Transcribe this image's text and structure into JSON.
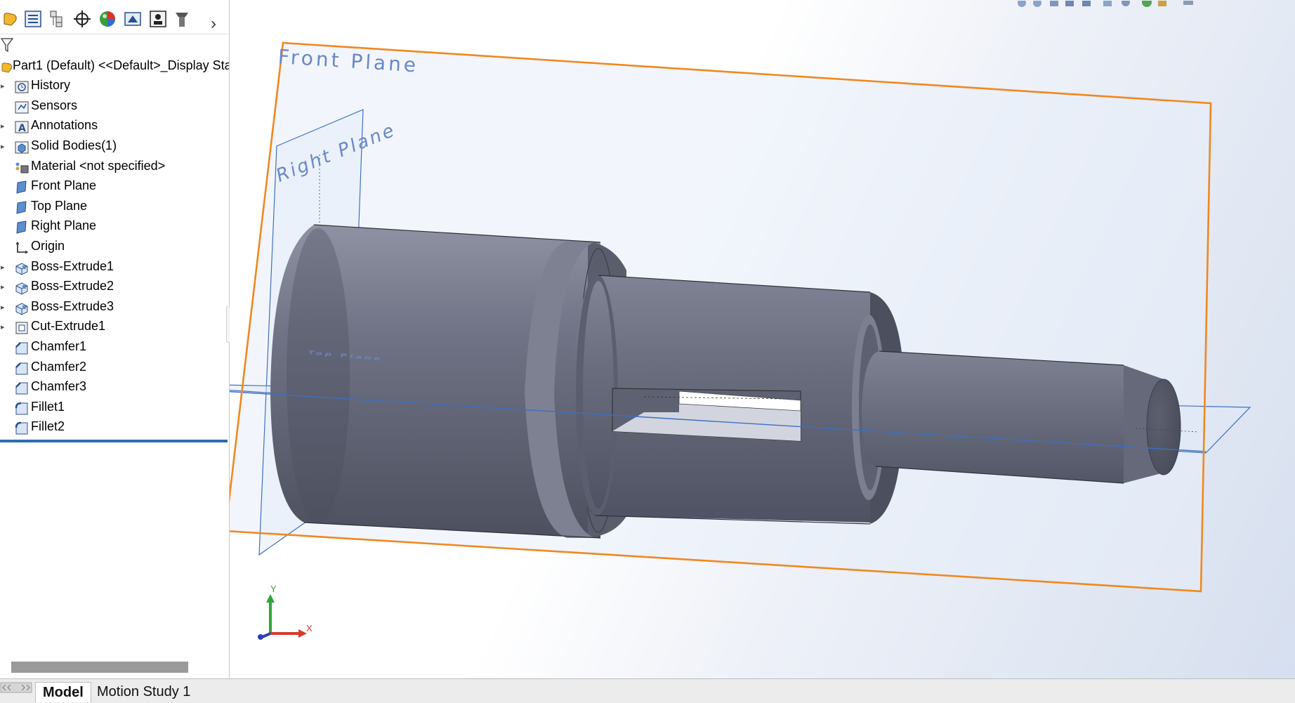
{
  "feature_manager": {
    "root": "Part1 (Default) <<Default>_Display Sta",
    "items": [
      {
        "label": "History",
        "icon": "history-icon",
        "expandable": true
      },
      {
        "label": "Sensors",
        "icon": "sensors-icon",
        "expandable": false
      },
      {
        "label": "Annotations",
        "icon": "annotations-icon",
        "expandable": true
      },
      {
        "label": "Solid Bodies(1)",
        "icon": "solid-bodies-icon",
        "expandable": true
      },
      {
        "label": "Material <not specified>",
        "icon": "material-icon",
        "expandable": false
      },
      {
        "label": "Front Plane",
        "icon": "plane-icon",
        "expandable": false
      },
      {
        "label": "Top Plane",
        "icon": "plane-icon",
        "expandable": false
      },
      {
        "label": "Right Plane",
        "icon": "plane-icon",
        "expandable": false
      },
      {
        "label": "Origin",
        "icon": "origin-icon",
        "expandable": false
      },
      {
        "label": "Boss-Extrude1",
        "icon": "boss-extrude-icon",
        "expandable": true
      },
      {
        "label": "Boss-Extrude2",
        "icon": "boss-extrude-icon",
        "expandable": true
      },
      {
        "label": "Boss-Extrude3",
        "icon": "boss-extrude-icon",
        "expandable": true
      },
      {
        "label": "Cut-Extrude1",
        "icon": "cut-extrude-icon",
        "expandable": true
      },
      {
        "label": "Chamfer1",
        "icon": "chamfer-icon",
        "expandable": false
      },
      {
        "label": "Chamfer2",
        "icon": "chamfer-icon",
        "expandable": false
      },
      {
        "label": "Chamfer3",
        "icon": "chamfer-icon",
        "expandable": false
      },
      {
        "label": "Fillet1",
        "icon": "fillet-icon",
        "expandable": false
      },
      {
        "label": "Fillet2",
        "icon": "fillet-icon",
        "expandable": false
      }
    ]
  },
  "panel_tabs": [
    "feature-manager-icon",
    "property-manager-icon",
    "configuration-manager-icon",
    "dimxpert-icon",
    "display-manager-icon",
    "cam-icon",
    "appearance-icon",
    "custom-icon"
  ],
  "viewport": {
    "planes": {
      "front": "Front Plane",
      "right": "Right Plane",
      "top": "Top Plane"
    },
    "triad": {
      "x": "X",
      "y": "Y"
    },
    "colors": {
      "part": "#6d7183",
      "part_dark": "#4e5161",
      "plane_selected": "#f0881f",
      "plane_edge": "#3f6fbf",
      "plane_label": "#6a88c6"
    }
  },
  "tabs": {
    "model": "Model",
    "motion": "Motion Study 1"
  }
}
